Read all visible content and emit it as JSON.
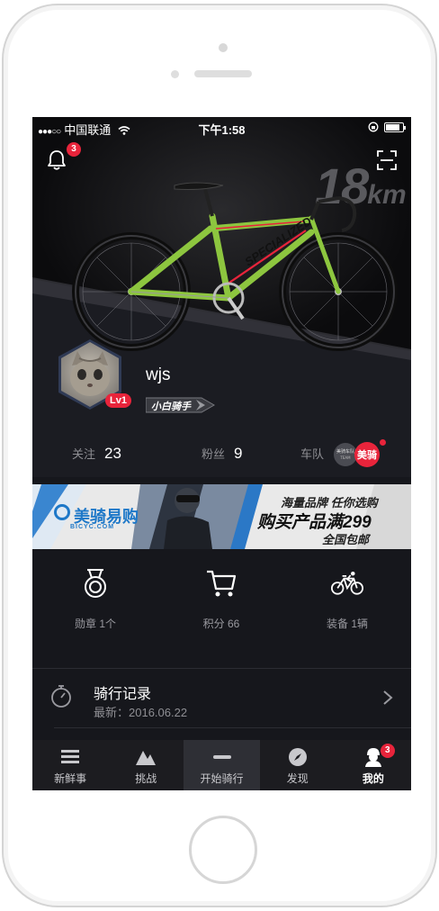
{
  "status_bar": {
    "signal_dots": "●●●○○",
    "carrier": "中国联通",
    "time": "下午1:58",
    "battery_level": 0.85
  },
  "header": {
    "notification_count": "3",
    "distance_value": "18",
    "distance_unit": "km"
  },
  "profile": {
    "username": "wjs",
    "level": "Lv1",
    "rank_title": "小白骑手"
  },
  "stats": {
    "following_label": "关注",
    "following_value": "23",
    "fans_label": "粉丝",
    "fans_value": "9",
    "team_label": "车队",
    "team_logo_text": "美骑"
  },
  "banner": {
    "brand": "美骑易购",
    "brand_domain": "BICYC.COM",
    "line1": "海量品牌 任你选购",
    "line2": "购买产品满299",
    "line3": "全国包邮"
  },
  "features": [
    {
      "label": "勋章 1个",
      "icon": "medal-icon"
    },
    {
      "label": "积分 66",
      "icon": "cart-icon"
    },
    {
      "label": "装备 1辆",
      "icon": "bicycle-icon"
    }
  ],
  "record": {
    "title": "骑行记录",
    "subtitle": "最新：2016.06.22"
  },
  "tabs": [
    {
      "label": "新鲜事",
      "icon": "list-icon"
    },
    {
      "label": "挑战",
      "icon": "mountain-icon"
    },
    {
      "label": "开始骑行",
      "icon": "start-ride-icon"
    },
    {
      "label": "发现",
      "icon": "compass-icon"
    },
    {
      "label": "我的",
      "icon": "profile-icon",
      "badge": "3"
    }
  ],
  "colors": {
    "accent_red": "#e8243b",
    "background": "#16171c",
    "bike_green": "#8dc63f",
    "banner_blue": "#1e78c8"
  }
}
